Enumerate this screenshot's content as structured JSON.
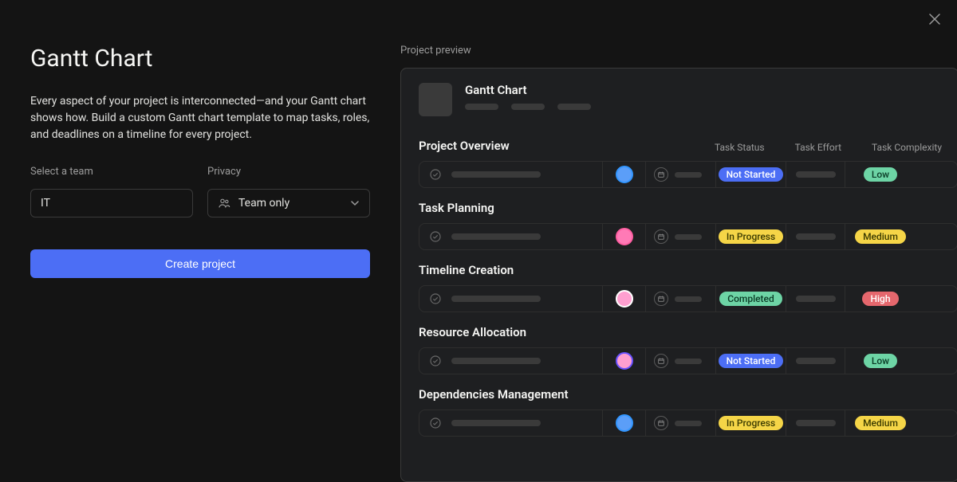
{
  "close": "✕",
  "title": "Gantt Chart",
  "description": "Every aspect of your project is interconnected—and your Gantt chart shows how. Build a custom Gantt chart template to map tasks, roles, and deadlines on a timeline for every project.",
  "form": {
    "team_label": "Select a team",
    "team_value": "IT",
    "privacy_label": "Privacy",
    "privacy_value": "Team only"
  },
  "create_button": "Create project",
  "preview_label": "Project preview",
  "preview_title": "Gantt Chart",
  "columns": {
    "status": "Task Status",
    "effort": "Task Effort",
    "complexity": "Task Complexity"
  },
  "sections": [
    {
      "title": "Project Overview",
      "show_headers": true,
      "status_label": "Not Started",
      "status_class": "badge-notstarted",
      "complexity_label": "Low",
      "complexity_class": "badge-low",
      "avatar_bg": "#5b9ef8",
      "avatar_border": "#3296ff"
    },
    {
      "title": "Task Planning",
      "show_headers": false,
      "status_label": "In Progress",
      "status_class": "badge-inprogress",
      "complexity_label": "Medium",
      "complexity_class": "badge-medium",
      "avatar_bg": "#ff7ab6",
      "avatar_border": "#ff5fa2"
    },
    {
      "title": "Timeline Creation",
      "show_headers": false,
      "status_label": "Completed",
      "status_class": "badge-completed",
      "complexity_label": "High",
      "complexity_class": "badge-high",
      "avatar_bg": "#ff9fd0",
      "avatar_border": "#ffffff"
    },
    {
      "title": "Resource Allocation",
      "show_headers": false,
      "status_label": "Not Started",
      "status_class": "badge-notstarted",
      "complexity_label": "Low",
      "complexity_class": "badge-low",
      "avatar_bg": "#ff9fd0",
      "avatar_border": "#6a52ff"
    },
    {
      "title": "Dependencies Management",
      "show_headers": false,
      "status_label": "In Progress",
      "status_class": "badge-inprogress",
      "complexity_label": "Medium",
      "complexity_class": "badge-medium",
      "avatar_bg": "#5b9ef8",
      "avatar_border": "#3296ff"
    }
  ]
}
